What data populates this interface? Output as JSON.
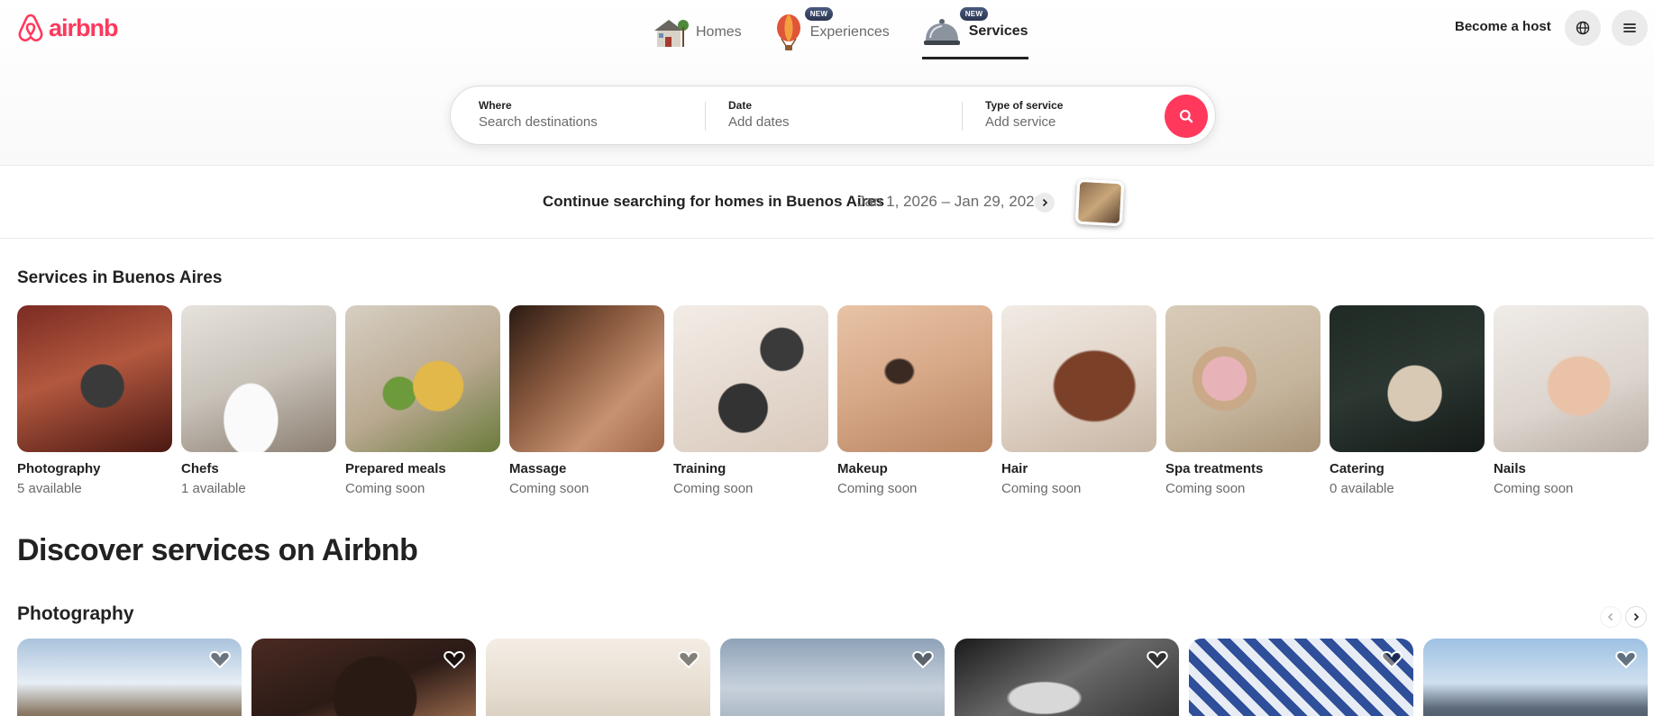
{
  "brand": {
    "name": "airbnb",
    "color": "#ff385c"
  },
  "nav": {
    "tabs": [
      {
        "label": "Homes",
        "icon": "house-icon",
        "badge": ""
      },
      {
        "label": "Experiences",
        "icon": "hot-air-balloon-icon",
        "badge": "NEW"
      },
      {
        "label": "Services",
        "icon": "service-bell-icon",
        "badge": "NEW",
        "active": true
      }
    ]
  },
  "header": {
    "host_label": "Become a host",
    "language_icon": "globe-icon",
    "menu_icon": "hamburger-menu-icon"
  },
  "search": {
    "where_label": "Where",
    "where_placeholder": "Search destinations",
    "date_label": "Date",
    "date_placeholder": "Add dates",
    "type_label": "Type of service",
    "type_placeholder": "Add service",
    "button_icon": "search-icon"
  },
  "continue": {
    "text": "Continue searching for homes in Buenos Aires",
    "dates": "Jan 1, 2026 – Jan 29, 2026"
  },
  "services": {
    "title": "Services in Buenos Aires",
    "categories": [
      {
        "name": "Photography",
        "status": "5 available"
      },
      {
        "name": "Chefs",
        "status": "1 available"
      },
      {
        "name": "Prepared meals",
        "status": "Coming soon"
      },
      {
        "name": "Massage",
        "status": "Coming soon"
      },
      {
        "name": "Training",
        "status": "Coming soon"
      },
      {
        "name": "Makeup",
        "status": "Coming soon"
      },
      {
        "name": "Hair",
        "status": "Coming soon"
      },
      {
        "name": "Spa treatments",
        "status": "Coming soon"
      },
      {
        "name": "Catering",
        "status": "0 available"
      },
      {
        "name": "Nails",
        "status": "Coming soon"
      }
    ]
  },
  "discover": {
    "title": "Discover services on Airbnb",
    "photography_title": "Photography"
  }
}
